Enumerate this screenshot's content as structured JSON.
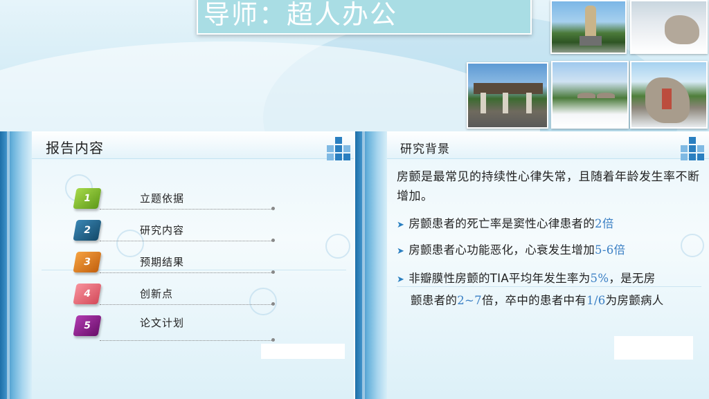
{
  "title_slide": {
    "title": "导师：超人办公"
  },
  "agenda_slide": {
    "heading": "报告内容",
    "items": [
      {
        "num": "1",
        "label": "立题依据",
        "color": "#7ab52a"
      },
      {
        "num": "2",
        "label": "研究内容",
        "color": "#1f5f86"
      },
      {
        "num": "3",
        "label": "预期结果",
        "color": "#e07a1e"
      },
      {
        "num": "4",
        "label": "创新点",
        "color": "#e86a78"
      },
      {
        "num": "5",
        "label": "论文计划",
        "color": "#8b1d8a"
      }
    ]
  },
  "background_slide": {
    "heading": "研究背景",
    "intro": "房颤是最常见的持续性心律失常，且随着年龄发生率不断增加。",
    "bullet1": {
      "text": "房颤患者的死亡率是窦性心律患者的",
      "hl": "2倍"
    },
    "bullet2": {
      "text": "房颤患者心功能恶化，心衰发生增加",
      "hl": "5-6倍"
    },
    "bullet3": {
      "t1": "非瓣膜性房颤的TIA平均年发生率为",
      "hl1": "5%",
      "t2": "，是无房",
      "t3": "颤患者的",
      "hl2": "2~7",
      "t4": "倍，卒中的患者中有",
      "hl3": "1/6",
      "t5": "为房颤病人"
    }
  }
}
